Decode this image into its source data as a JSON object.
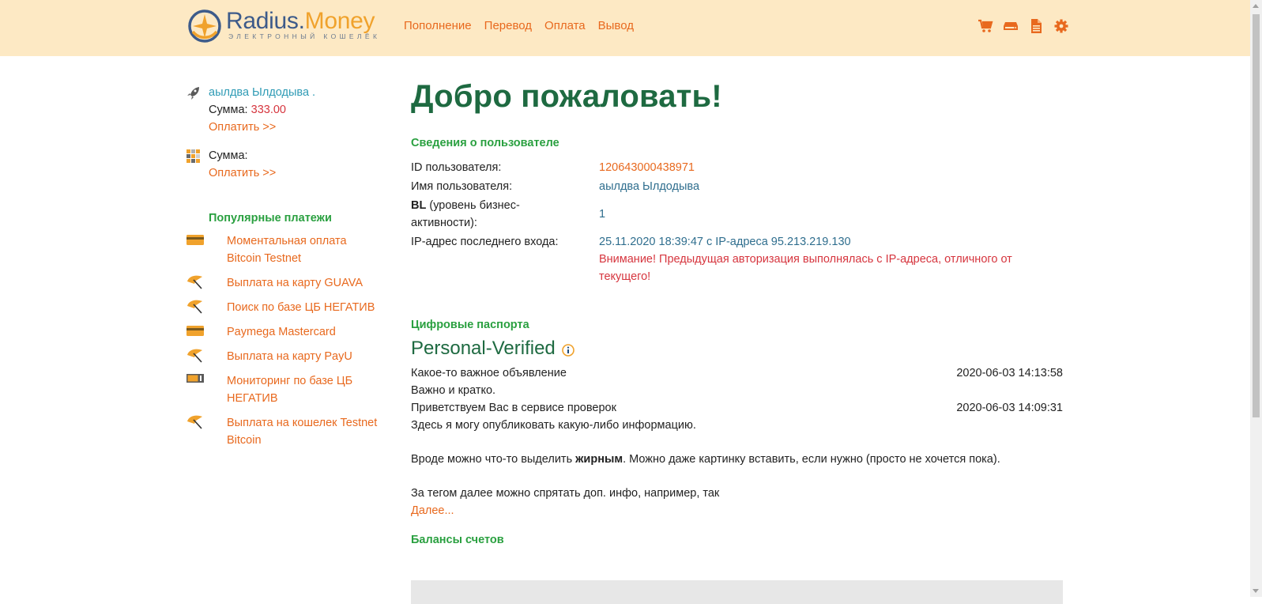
{
  "brand": {
    "name_part1": "Radius.",
    "name_part2": "Money",
    "tagline": "ЭЛЕКТРОННЫЙ КОШЕЛЁК"
  },
  "nav": [
    "Пополнение",
    "Перевод",
    "Оплата",
    "Вывод"
  ],
  "toolbar_icons": [
    "cart-icon",
    "wallet-icon",
    "document-icon",
    "gear-icon"
  ],
  "sidebar": {
    "account1": {
      "user": "аылдва Ылдодыва .",
      "sum_label": "Сумма:",
      "sum_value": "333.00",
      "pay_link": "Оплатить >>"
    },
    "account2": {
      "sum_label": "Сумма:",
      "pay_link": "Оплатить >>"
    },
    "popular_title": "Популярные платежи",
    "popular": [
      {
        "label": "Моментальная оплата Bitcoin Testnet",
        "icon": "card-icon"
      },
      {
        "label": "Выплата на карту GUAVA",
        "icon": "umbrella-icon"
      },
      {
        "label": "Поиск по базе ЦБ НЕГАТИВ",
        "icon": "umbrella-icon"
      },
      {
        "label": "Paymega Mastercard",
        "icon": "card-icon"
      },
      {
        "label": "Выплата на карту PayU",
        "icon": "umbrella-icon"
      },
      {
        "label": "Мониторинг по базе ЦБ НЕГАТИВ",
        "icon": "battery-card-icon"
      },
      {
        "label": "Выплата на кошелек Testnet Bitcoin",
        "icon": "umbrella-icon"
      }
    ]
  },
  "main": {
    "welcome": "Добро пожаловать!",
    "user_info_title": "Сведения о пользователе",
    "user_info": {
      "id_label": "ID пользователя:",
      "id_value": "120643000438971",
      "name_label": "Имя пользователя:",
      "name_value": "аылдва Ылдодыва",
      "bl_bold": "BL",
      "bl_rest": " (уровень бизнес-активности):",
      "bl_value": "1",
      "ip_label": "IP-адрес последнего входа:",
      "ip_value": "25.11.2020 18:39:47 с IP-адреса 95.213.219.130",
      "ip_warning": "Внимание! Предыдущая авторизация выполнялась с IP-адреса, отличного от текущего!"
    },
    "passports_title": "Цифровые паспорта",
    "passport_status": "Personal-Verified",
    "news": [
      {
        "title": "Какое-то важное объявление",
        "date": "2020-06-03 14:13:58",
        "body": "Важно и кратко."
      },
      {
        "title": "Приветствуем Вас в сервисе проверок",
        "date": "2020-06-03 14:09:31",
        "body": "Здесь я могу опубликовать какую-либо информацию."
      }
    ],
    "news_extra": {
      "p1_start": "Вроде можно что-то выделить ",
      "p1_bold": "жирным",
      "p1_end": ". Можно даже картинку вставить, если нужно (просто не хочется пока).",
      "p2": "За тегом далее можно спрятать доп. инфо, например, так",
      "more_link": "Далее..."
    },
    "balances_title": "Балансы счетов"
  }
}
